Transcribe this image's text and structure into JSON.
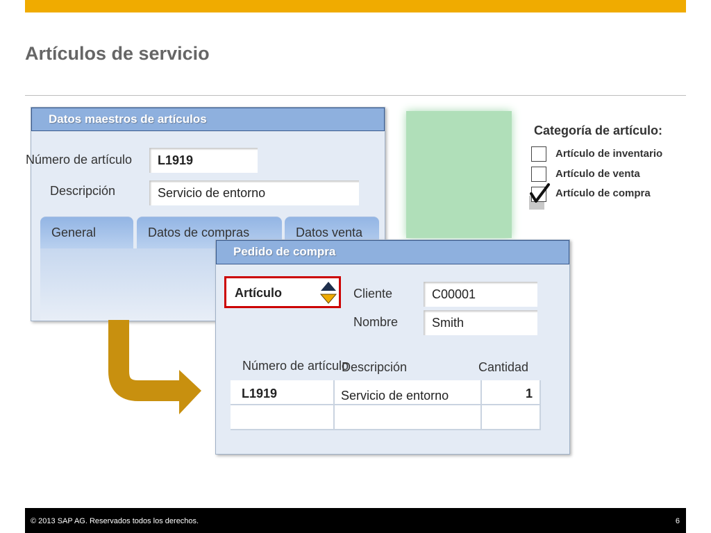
{
  "slide": {
    "title": "Artículos de servicio"
  },
  "master": {
    "header": "Datos maestros de artículos",
    "item_number_label": "Número de artículo",
    "item_number_value": "L1919",
    "description_label": "Descripción",
    "description_value": "Servicio de entorno",
    "tabs": [
      "General",
      "Datos de compras",
      "Datos venta"
    ]
  },
  "category": {
    "title": "Categoría de artículo:",
    "options": [
      {
        "label": "Artículo de inventario",
        "checked": false
      },
      {
        "label": "Artículo de venta",
        "checked": false
      },
      {
        "label": "Artículo de compra",
        "checked": true
      }
    ]
  },
  "purchase_order": {
    "header": "Pedido de compra",
    "type_selector": "Artículo",
    "customer_label": "Cliente",
    "customer_value": "C00001",
    "name_label": "Nombre",
    "name_value": "Smith",
    "columns": [
      "Número de artículo",
      "Descripción",
      "Cantidad"
    ],
    "rows": [
      {
        "item": "L1919",
        "description": "Servicio de entorno",
        "quantity": "1"
      },
      {
        "item": "",
        "description": "",
        "quantity": ""
      }
    ]
  },
  "footer": {
    "copyright": "© 2013 SAP AG. Reservados todos los derechos.",
    "page": "6"
  },
  "colors": {
    "accent": "#f0ab00",
    "header_blue": "#8eb0de",
    "arrow": "#c8900f",
    "selector_border": "#cc0000"
  },
  "icons": {
    "photo": "image-placeholder",
    "flow": "arrow-down-right-icon",
    "selector": "up-down-arrows-icon",
    "check": "checkmark-icon"
  }
}
